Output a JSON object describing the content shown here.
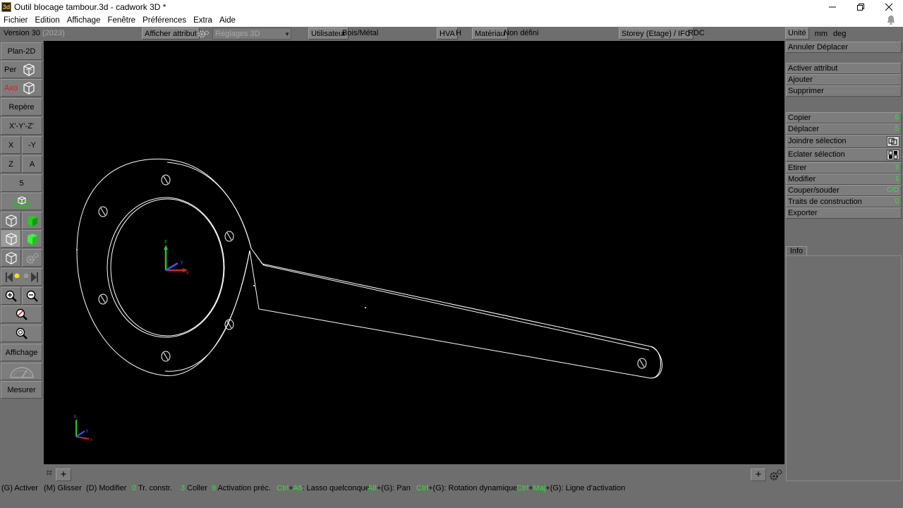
{
  "window": {
    "title": "Outil blocage tambour.3d - cadwork 3D *",
    "app_icon_text": "3d"
  },
  "menu": [
    "Fichier",
    "Edition",
    "Affichage",
    "Fenêtre",
    "Préférences",
    "Extra",
    "Aide"
  ],
  "attrbar": {
    "version": "Version 30",
    "version_year": "(2023)",
    "afficher_attribut": "Afficher attribut",
    "reglages_3d": "Réglages 3D",
    "utilisateur_label": "Utilisateur",
    "utilisateur_value": "Bois/Métal",
    "hva_label": "HVA",
    "hva_value": "H",
    "materiau_label": "Matériau",
    "materiau_value": "Non défini",
    "storey_label": "Storey (Etage) / IFC",
    "storey_value": "RDC"
  },
  "units": {
    "label": "Unité",
    "length": "mm",
    "angle": "deg"
  },
  "leftbar": {
    "plan2d": "Plan-2D",
    "per": "Per",
    "axo": "Axo",
    "repere": "Repère",
    "xyz_neg": "X'-Y'-Z'",
    "x": "X",
    "neg_y": "-Y",
    "z": "Z",
    "a": "A",
    "five": "5",
    "affichage": "Affichage",
    "mesurer": "Mesurer"
  },
  "rightpanel": {
    "annuler": "Annuler Déplacer",
    "activer_attribut": "Activer attribut",
    "ajouter": "Ajouter",
    "supprimer": "Supprimer",
    "copier": {
      "label": "Copier",
      "key": "6"
    },
    "deplacer": {
      "label": "Déplacer",
      "key": "5"
    },
    "joindre": "Joindre sélection",
    "eclater": "Eclater sélection",
    "etirer": {
      "label": "Etirer",
      "key": "7"
    },
    "modifier": {
      "label": "Modifier",
      "key": "1"
    },
    "couper": {
      "label": "Couper/souder",
      "key": "C/D"
    },
    "traits": {
      "label": "Traits de construction",
      "key": "0"
    },
    "exporter": "Exporter",
    "info_tab": "Info"
  },
  "viewport": {
    "axis_x": "x",
    "axis_y": "y",
    "axis_z": "z"
  },
  "statusbar": {
    "activer": "(G) Activer",
    "glisser": "(M) Glisser",
    "modifier": "(D) Modifier",
    "trconstr_key": "0",
    "trconstr": " Tr. constr.",
    "coller_key": "3",
    "coller": " Coller",
    "activation_key": "9",
    "activation": " Activation préc.",
    "lasso_ctrl": "Ctrl",
    "lasso_plus": "+",
    "lasso_alt": "Alt",
    "lasso_text": ": Lasso quelconque",
    "pan_alt": "Alt",
    "pan_text": "+(G): Pan",
    "rot_ctrl": "Ctrl",
    "rot_text": "+(G): Rotation dynamique",
    "ligne_ctrl": "Ctrl",
    "ligne_plus": "+",
    "ligne_maj": "Maj",
    "ligne_text": "+(G): Ligne d'activation"
  }
}
